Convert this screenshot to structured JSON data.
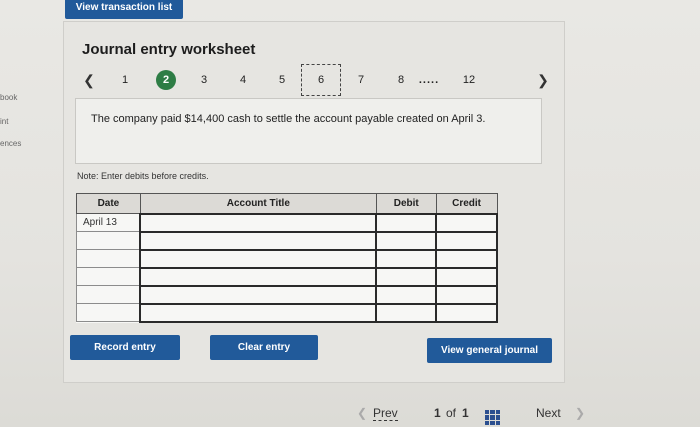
{
  "sidebar": {
    "items": [
      "book",
      "int",
      "ences"
    ]
  },
  "top": {
    "view_transactions": "View transaction list"
  },
  "worksheet": {
    "title": "Journal entry worksheet",
    "pager": {
      "prev_icon": "chevron-left",
      "next_icon": "chevron-right",
      "pages": [
        "1",
        "2",
        "3",
        "4",
        "5",
        "6",
        "7",
        "8",
        ".....",
        "12"
      ],
      "active": "2",
      "current": "6"
    },
    "description": "The company paid $14,400 cash to settle the account payable created on April 3.",
    "note": "Note: Enter debits before credits.",
    "table": {
      "headers": {
        "date": "Date",
        "account": "Account Title",
        "debit": "Debit",
        "credit": "Credit"
      },
      "rows": [
        {
          "date": "April 13",
          "account": "",
          "debit": "",
          "credit": ""
        },
        {
          "date": "",
          "account": "",
          "debit": "",
          "credit": ""
        },
        {
          "date": "",
          "account": "",
          "debit": "",
          "credit": ""
        },
        {
          "date": "",
          "account": "",
          "debit": "",
          "credit": ""
        },
        {
          "date": "",
          "account": "",
          "debit": "",
          "credit": ""
        },
        {
          "date": "",
          "account": "",
          "debit": "",
          "credit": ""
        }
      ]
    },
    "buttons": {
      "record": "Record entry",
      "clear": "Clear entry",
      "general_journal": "View general journal"
    }
  },
  "footer": {
    "prev": "Prev",
    "page_current": "1",
    "page_of": "of",
    "page_total": "1",
    "next": "Next"
  },
  "colors": {
    "button": "#215a9a",
    "active_page": "#2e7d45"
  }
}
